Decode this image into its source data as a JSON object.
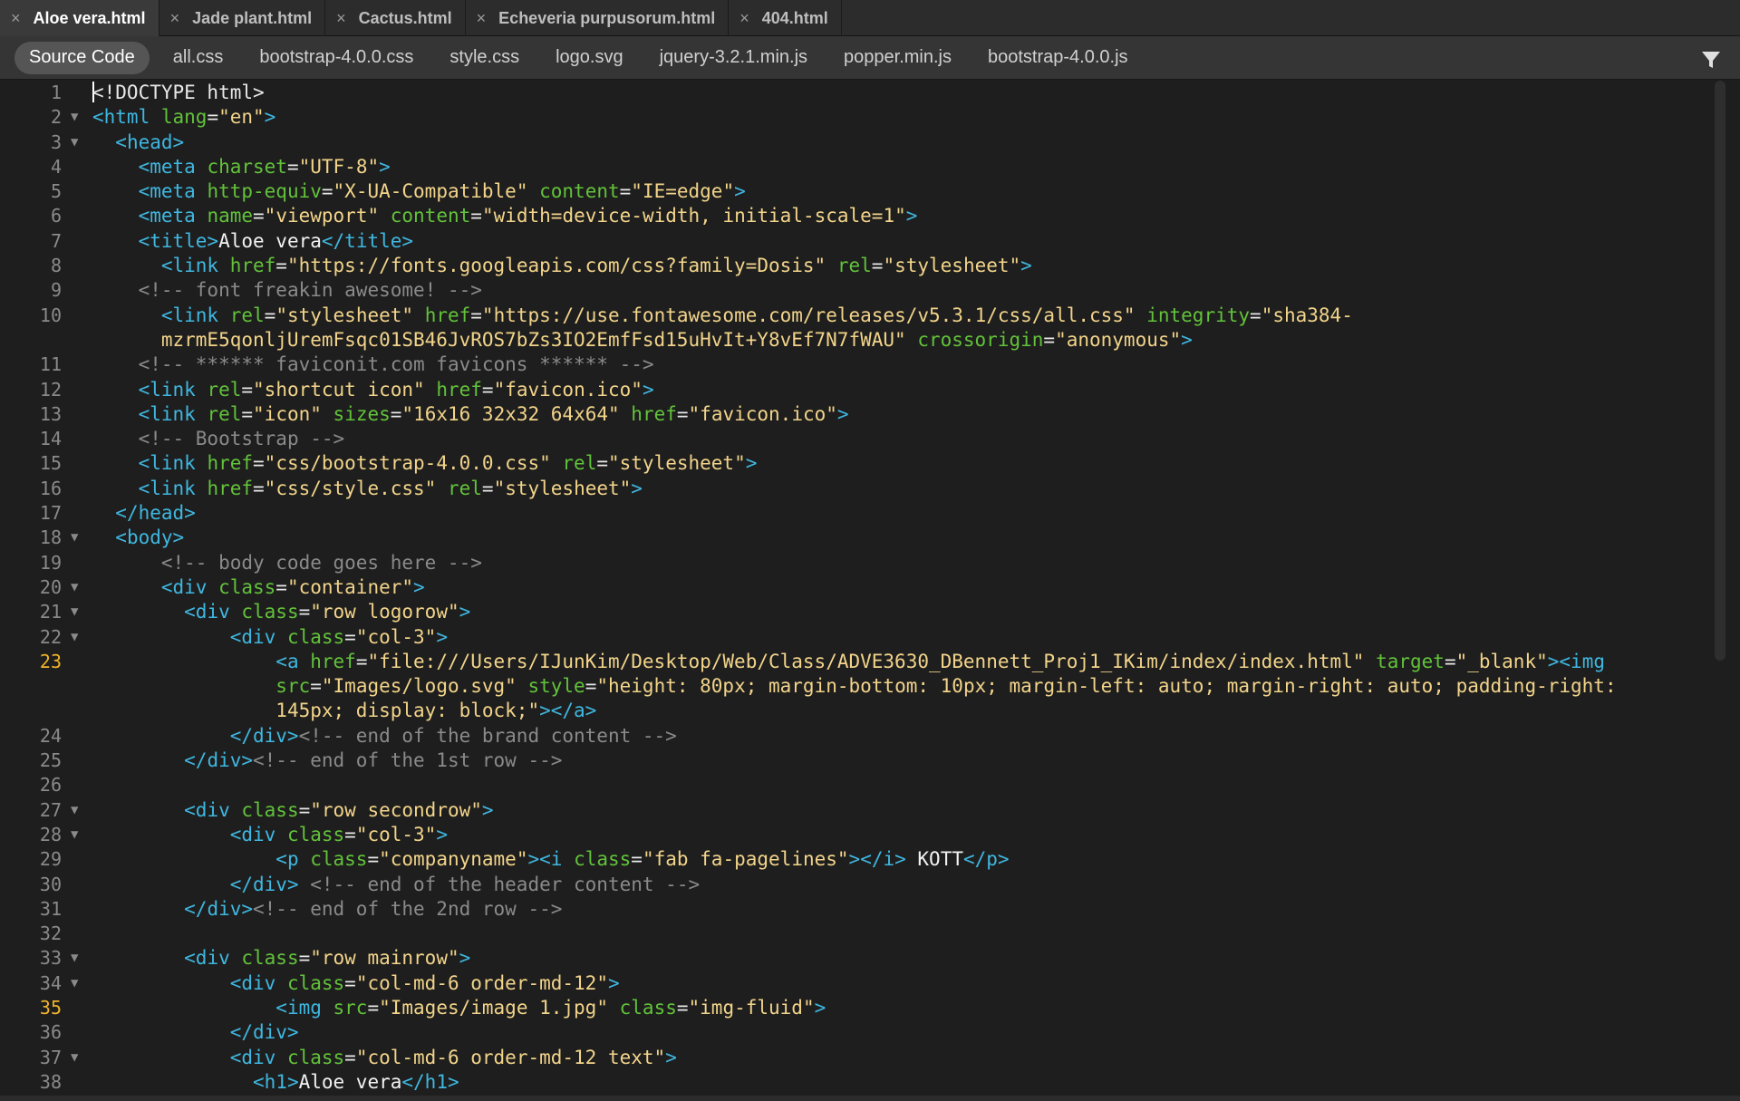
{
  "doc_tabs": [
    {
      "label": "Aloe vera.html",
      "active": true
    },
    {
      "label": "Jade plant.html",
      "active": false
    },
    {
      "label": "Cactus.html",
      "active": false
    },
    {
      "label": "Echeveria purpusorum.html",
      "active": false
    },
    {
      "label": "404.html",
      "active": false
    }
  ],
  "close_glyph": "×",
  "related_files": [
    {
      "label": "Source Code",
      "active": true
    },
    {
      "label": "all.css"
    },
    {
      "label": "bootstrap-4.0.0.css"
    },
    {
      "label": "style.css"
    },
    {
      "label": "logo.svg"
    },
    {
      "label": "jquery-3.2.1.min.js"
    },
    {
      "label": "popper.min.js"
    },
    {
      "label": "bootstrap-4.0.0.js"
    }
  ],
  "filter_icon": "filter-icon",
  "highlighted_line_numbers": [
    23,
    35
  ],
  "code_lines": [
    {
      "n": "1",
      "fold": false,
      "tokens": [
        [
          "cur",
          ""
        ],
        [
          "pun",
          "<!DOCTYPE html>"
        ]
      ]
    },
    {
      "n": "2",
      "fold": true,
      "tokens": [
        [
          "tag",
          "<html "
        ],
        [
          "attr",
          "lang"
        ],
        [
          "pun",
          "="
        ],
        [
          "str",
          "\"en\""
        ],
        [
          "tag",
          ">"
        ]
      ]
    },
    {
      "n": "3",
      "fold": true,
      "tokens": [
        [
          "pun",
          "  "
        ],
        [
          "tag",
          "<head>"
        ]
      ]
    },
    {
      "n": "4",
      "fold": false,
      "tokens": [
        [
          "pun",
          "    "
        ],
        [
          "tag",
          "<meta "
        ],
        [
          "attr",
          "charset"
        ],
        [
          "pun",
          "="
        ],
        [
          "str",
          "\"UTF-8\""
        ],
        [
          "tag",
          ">"
        ]
      ]
    },
    {
      "n": "5",
      "fold": false,
      "tokens": [
        [
          "pun",
          "    "
        ],
        [
          "tag",
          "<meta "
        ],
        [
          "attr",
          "http-equiv"
        ],
        [
          "pun",
          "="
        ],
        [
          "str",
          "\"X-UA-Compatible\""
        ],
        [
          "pun",
          " "
        ],
        [
          "attr",
          "content"
        ],
        [
          "pun",
          "="
        ],
        [
          "str",
          "\"IE=edge\""
        ],
        [
          "tag",
          ">"
        ]
      ]
    },
    {
      "n": "6",
      "fold": false,
      "tokens": [
        [
          "pun",
          "    "
        ],
        [
          "tag",
          "<meta "
        ],
        [
          "attr",
          "name"
        ],
        [
          "pun",
          "="
        ],
        [
          "str",
          "\"viewport\""
        ],
        [
          "pun",
          " "
        ],
        [
          "attr",
          "content"
        ],
        [
          "pun",
          "="
        ],
        [
          "str",
          "\"width=device-width, initial-scale=1\""
        ],
        [
          "tag",
          ">"
        ]
      ]
    },
    {
      "n": "7",
      "fold": false,
      "tokens": [
        [
          "pun",
          "    "
        ],
        [
          "tag",
          "<title>"
        ],
        [
          "text",
          "Aloe vera"
        ],
        [
          "tag",
          "</title>"
        ]
      ]
    },
    {
      "n": "8",
      "fold": false,
      "tokens": [
        [
          "pun",
          "      "
        ],
        [
          "tag",
          "<link "
        ],
        [
          "attr",
          "href"
        ],
        [
          "pun",
          "="
        ],
        [
          "str",
          "\"https://fonts.googleapis.com/css?family=Dosis\""
        ],
        [
          "pun",
          " "
        ],
        [
          "attr",
          "rel"
        ],
        [
          "pun",
          "="
        ],
        [
          "str",
          "\"stylesheet\""
        ],
        [
          "tag",
          ">"
        ]
      ]
    },
    {
      "n": "9",
      "fold": false,
      "tokens": [
        [
          "pun",
          "    "
        ],
        [
          "com",
          "<!-- font freakin awesome! -->"
        ]
      ]
    },
    {
      "n": "10",
      "fold": false,
      "tokens": [
        [
          "pun",
          "      "
        ],
        [
          "tag",
          "<link "
        ],
        [
          "attr",
          "rel"
        ],
        [
          "pun",
          "="
        ],
        [
          "str",
          "\"stylesheet\""
        ],
        [
          "pun",
          " "
        ],
        [
          "attr",
          "href"
        ],
        [
          "pun",
          "="
        ],
        [
          "str",
          "\"https://use.fontawesome.com/releases/v5.3.1/css/all.css\""
        ],
        [
          "pun",
          " "
        ],
        [
          "attr",
          "integrity"
        ],
        [
          "pun",
          "="
        ],
        [
          "str",
          "\"sha384-"
        ]
      ]
    },
    {
      "n": "",
      "fold": false,
      "tokens": [
        [
          "pun",
          "      "
        ],
        [
          "str",
          "mzrmE5qonljUremFsqc01SB46JvROS7bZs3IO2EmfFsd15uHvIt+Y8vEf7N7fWAU\""
        ],
        [
          "pun",
          " "
        ],
        [
          "attr",
          "crossorigin"
        ],
        [
          "pun",
          "="
        ],
        [
          "str",
          "\"anonymous\""
        ],
        [
          "tag",
          ">"
        ]
      ]
    },
    {
      "n": "11",
      "fold": false,
      "tokens": [
        [
          "pun",
          "    "
        ],
        [
          "com",
          "<!-- ****** faviconit.com favicons ****** -->"
        ]
      ]
    },
    {
      "n": "12",
      "fold": false,
      "tokens": [
        [
          "pun",
          "    "
        ],
        [
          "tag",
          "<link "
        ],
        [
          "attr",
          "rel"
        ],
        [
          "pun",
          "="
        ],
        [
          "str",
          "\"shortcut icon\""
        ],
        [
          "pun",
          " "
        ],
        [
          "attr",
          "href"
        ],
        [
          "pun",
          "="
        ],
        [
          "str",
          "\"favicon.ico\""
        ],
        [
          "tag",
          ">"
        ]
      ]
    },
    {
      "n": "13",
      "fold": false,
      "tokens": [
        [
          "pun",
          "    "
        ],
        [
          "tag",
          "<link "
        ],
        [
          "attr",
          "rel"
        ],
        [
          "pun",
          "="
        ],
        [
          "str",
          "\"icon\""
        ],
        [
          "pun",
          " "
        ],
        [
          "attr",
          "sizes"
        ],
        [
          "pun",
          "="
        ],
        [
          "str",
          "\"16x16 32x32 64x64\""
        ],
        [
          "pun",
          " "
        ],
        [
          "attr",
          "href"
        ],
        [
          "pun",
          "="
        ],
        [
          "str",
          "\"favicon.ico\""
        ],
        [
          "tag",
          ">"
        ]
      ]
    },
    {
      "n": "14",
      "fold": false,
      "tokens": [
        [
          "pun",
          "    "
        ],
        [
          "com",
          "<!-- Bootstrap -->"
        ]
      ]
    },
    {
      "n": "15",
      "fold": false,
      "tokens": [
        [
          "pun",
          "    "
        ],
        [
          "tag",
          "<link "
        ],
        [
          "attr",
          "href"
        ],
        [
          "pun",
          "="
        ],
        [
          "str",
          "\"css/bootstrap-4.0.0.css\""
        ],
        [
          "pun",
          " "
        ],
        [
          "attr",
          "rel"
        ],
        [
          "pun",
          "="
        ],
        [
          "str",
          "\"stylesheet\""
        ],
        [
          "tag",
          ">"
        ]
      ]
    },
    {
      "n": "16",
      "fold": false,
      "tokens": [
        [
          "pun",
          "    "
        ],
        [
          "tag",
          "<link "
        ],
        [
          "attr",
          "href"
        ],
        [
          "pun",
          "="
        ],
        [
          "str",
          "\"css/style.css\""
        ],
        [
          "pun",
          " "
        ],
        [
          "attr",
          "rel"
        ],
        [
          "pun",
          "="
        ],
        [
          "str",
          "\"stylesheet\""
        ],
        [
          "tag",
          ">"
        ]
      ]
    },
    {
      "n": "17",
      "fold": false,
      "tokens": [
        [
          "pun",
          "  "
        ],
        [
          "tag",
          "</head>"
        ]
      ]
    },
    {
      "n": "18",
      "fold": true,
      "tokens": [
        [
          "pun",
          "  "
        ],
        [
          "tag",
          "<body>"
        ]
      ]
    },
    {
      "n": "19",
      "fold": false,
      "tokens": [
        [
          "pun",
          "      "
        ],
        [
          "com",
          "<!-- body code goes here -->"
        ]
      ]
    },
    {
      "n": "20",
      "fold": true,
      "tokens": [
        [
          "pun",
          "      "
        ],
        [
          "tag",
          "<div "
        ],
        [
          "attr",
          "class"
        ],
        [
          "pun",
          "="
        ],
        [
          "str",
          "\"container\""
        ],
        [
          "tag",
          ">"
        ]
      ]
    },
    {
      "n": "21",
      "fold": true,
      "tokens": [
        [
          "pun",
          "        "
        ],
        [
          "tag",
          "<div "
        ],
        [
          "attr",
          "class"
        ],
        [
          "pun",
          "="
        ],
        [
          "str",
          "\"row logorow\""
        ],
        [
          "tag",
          ">"
        ]
      ]
    },
    {
      "n": "22",
      "fold": true,
      "tokens": [
        [
          "pun",
          "            "
        ],
        [
          "tag",
          "<div "
        ],
        [
          "attr",
          "class"
        ],
        [
          "pun",
          "="
        ],
        [
          "str",
          "\"col-3\""
        ],
        [
          "tag",
          ">"
        ]
      ]
    },
    {
      "n": "23",
      "fold": false,
      "tokens": [
        [
          "pun",
          "                "
        ],
        [
          "tag",
          "<a "
        ],
        [
          "attr",
          "href"
        ],
        [
          "pun",
          "="
        ],
        [
          "str",
          "\"file:///Users/IJunKim/Desktop/Web/Class/ADVE3630_DBennett_Proj1_IKim/index/index.html\""
        ],
        [
          "pun",
          " "
        ],
        [
          "attr",
          "target"
        ],
        [
          "pun",
          "="
        ],
        [
          "str",
          "\"_blank\""
        ],
        [
          "tag",
          ">"
        ],
        [
          "tag",
          "<img"
        ]
      ]
    },
    {
      "n": "",
      "fold": false,
      "tokens": [
        [
          "pun",
          "                "
        ],
        [
          "attr",
          "src"
        ],
        [
          "pun",
          "="
        ],
        [
          "str",
          "\"Images/logo.svg\""
        ],
        [
          "pun",
          " "
        ],
        [
          "attr",
          "style"
        ],
        [
          "pun",
          "="
        ],
        [
          "str",
          "\"height: 80px; margin-bottom: 10px; margin-left: auto; margin-right: auto; padding-right:"
        ]
      ]
    },
    {
      "n": "",
      "fold": false,
      "tokens": [
        [
          "pun",
          "                "
        ],
        [
          "str",
          "145px; display: block;\""
        ],
        [
          "tag",
          ">"
        ],
        [
          "tag",
          "</a>"
        ]
      ]
    },
    {
      "n": "24",
      "fold": false,
      "tokens": [
        [
          "pun",
          "            "
        ],
        [
          "tag",
          "</div>"
        ],
        [
          "com",
          "<!-- end of the brand content -->"
        ]
      ]
    },
    {
      "n": "25",
      "fold": false,
      "tokens": [
        [
          "pun",
          "        "
        ],
        [
          "tag",
          "</div>"
        ],
        [
          "com",
          "<!-- end of the 1st row -->"
        ]
      ]
    },
    {
      "n": "26",
      "fold": false,
      "tokens": []
    },
    {
      "n": "27",
      "fold": true,
      "tokens": [
        [
          "pun",
          "        "
        ],
        [
          "tag",
          "<div "
        ],
        [
          "attr",
          "class"
        ],
        [
          "pun",
          "="
        ],
        [
          "str",
          "\"row secondrow\""
        ],
        [
          "tag",
          ">"
        ]
      ]
    },
    {
      "n": "28",
      "fold": true,
      "tokens": [
        [
          "pun",
          "            "
        ],
        [
          "tag",
          "<div "
        ],
        [
          "attr",
          "class"
        ],
        [
          "pun",
          "="
        ],
        [
          "str",
          "\"col-3\""
        ],
        [
          "tag",
          ">"
        ]
      ]
    },
    {
      "n": "29",
      "fold": false,
      "tokens": [
        [
          "pun",
          "                "
        ],
        [
          "tag",
          "<p "
        ],
        [
          "attr",
          "class"
        ],
        [
          "pun",
          "="
        ],
        [
          "str",
          "\"companyname\""
        ],
        [
          "tag",
          ">"
        ],
        [
          "tag",
          "<i "
        ],
        [
          "attr",
          "class"
        ],
        [
          "pun",
          "="
        ],
        [
          "str",
          "\"fab fa-pagelines\""
        ],
        [
          "tag",
          ">"
        ],
        [
          "tag",
          "</i>"
        ],
        [
          "text",
          " KOTT"
        ],
        [
          "tag",
          "</p>"
        ]
      ]
    },
    {
      "n": "30",
      "fold": false,
      "tokens": [
        [
          "pun",
          "            "
        ],
        [
          "tag",
          "</div>"
        ],
        [
          "pun",
          " "
        ],
        [
          "com",
          "<!-- end of the header content -->"
        ]
      ]
    },
    {
      "n": "31",
      "fold": false,
      "tokens": [
        [
          "pun",
          "        "
        ],
        [
          "tag",
          "</div>"
        ],
        [
          "com",
          "<!-- end of the 2nd row -->"
        ]
      ]
    },
    {
      "n": "32",
      "fold": false,
      "tokens": []
    },
    {
      "n": "33",
      "fold": true,
      "tokens": [
        [
          "pun",
          "        "
        ],
        [
          "tag",
          "<div "
        ],
        [
          "attr",
          "class"
        ],
        [
          "pun",
          "="
        ],
        [
          "str",
          "\"row mainrow\""
        ],
        [
          "tag",
          ">"
        ]
      ]
    },
    {
      "n": "34",
      "fold": true,
      "tokens": [
        [
          "pun",
          "            "
        ],
        [
          "tag",
          "<div "
        ],
        [
          "attr",
          "class"
        ],
        [
          "pun",
          "="
        ],
        [
          "str",
          "\"col-md-6 order-md-12\""
        ],
        [
          "tag",
          ">"
        ]
      ]
    },
    {
      "n": "35",
      "fold": false,
      "tokens": [
        [
          "pun",
          "                "
        ],
        [
          "tag",
          "<img "
        ],
        [
          "attr",
          "src"
        ],
        [
          "pun",
          "="
        ],
        [
          "str",
          "\"Images/image 1.jpg\""
        ],
        [
          "pun",
          " "
        ],
        [
          "attr",
          "class"
        ],
        [
          "pun",
          "="
        ],
        [
          "str",
          "\"img-fluid\""
        ],
        [
          "tag",
          ">"
        ]
      ]
    },
    {
      "n": "36",
      "fold": false,
      "tokens": [
        [
          "pun",
          "            "
        ],
        [
          "tag",
          "</div>"
        ]
      ]
    },
    {
      "n": "37",
      "fold": true,
      "tokens": [
        [
          "pun",
          "            "
        ],
        [
          "tag",
          "<div "
        ],
        [
          "attr",
          "class"
        ],
        [
          "pun",
          "="
        ],
        [
          "str",
          "\"col-md-6 order-md-12 text\""
        ],
        [
          "tag",
          ">"
        ]
      ]
    },
    {
      "n": "38",
      "fold": false,
      "tokens": [
        [
          "pun",
          "              "
        ],
        [
          "tag",
          "<h1>"
        ],
        [
          "text",
          "Aloe vera"
        ],
        [
          "tag",
          "</h1>"
        ]
      ]
    }
  ],
  "colors": {
    "background": "#1e1e1e",
    "tag": "#3fb7e0",
    "attribute": "#62c23a",
    "string": "#f2d48a",
    "comment": "#8a8a8a",
    "highlighted_line_number": "#f0b429"
  }
}
